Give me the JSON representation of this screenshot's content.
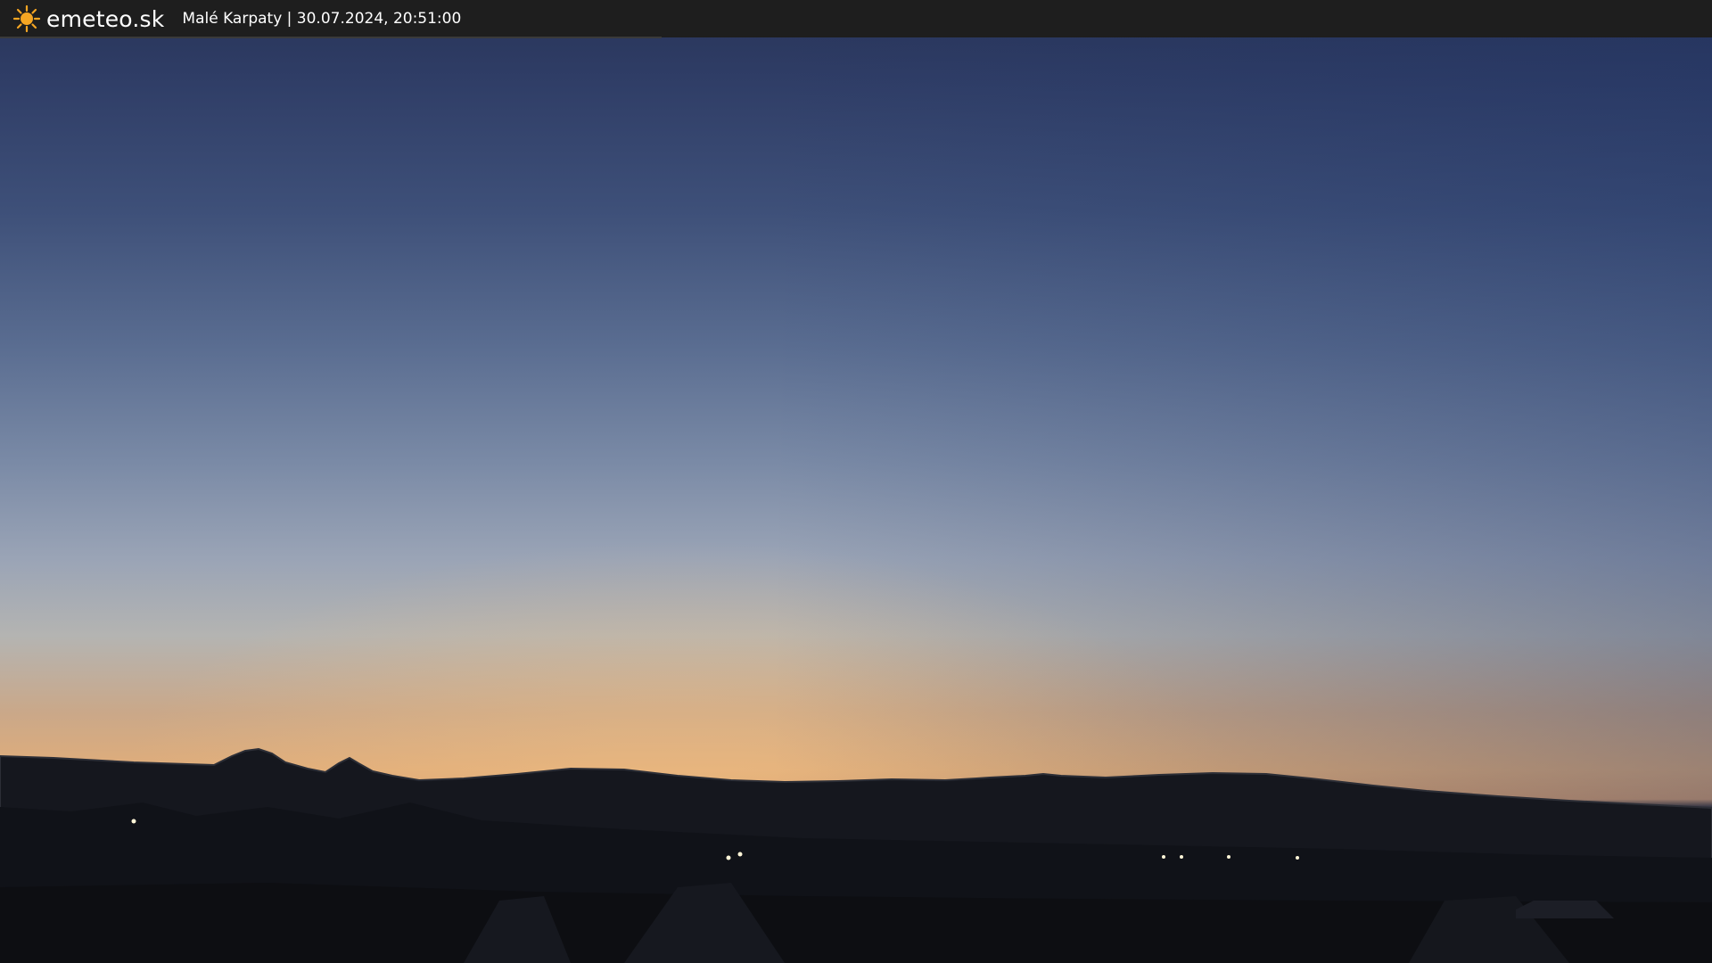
{
  "header": {
    "logo_icon": "sun-icon",
    "brand": "emeteo.sk",
    "caption": "Malé Karpaty | 30.07.2024, 20:51:00"
  },
  "colors": {
    "bar_background": "#1e1e1e",
    "sun_color": "#f5a623",
    "sky_top": "#283458",
    "horizon_glow": "#e0ad7a",
    "ridge": "#14161c"
  },
  "scene": {
    "lights": "town-lights"
  }
}
